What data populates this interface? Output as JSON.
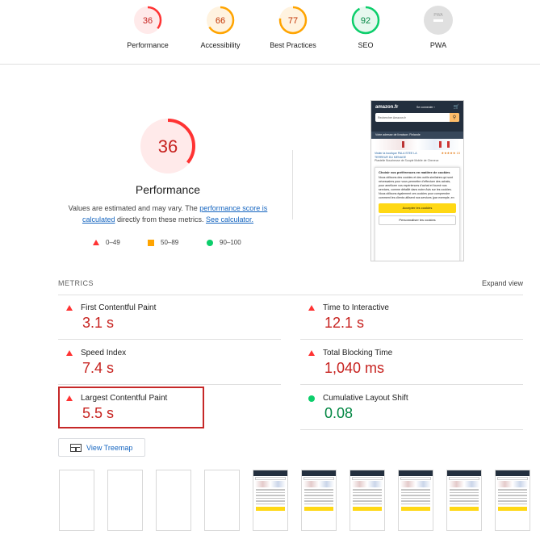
{
  "top_gauges": [
    {
      "score": "36",
      "label": "Performance",
      "value": 36,
      "rating": "fail"
    },
    {
      "score": "66",
      "label": "Accessibility",
      "value": 66,
      "rating": "average"
    },
    {
      "score": "77",
      "label": "Best Practices",
      "value": 77,
      "rating": "average"
    },
    {
      "score": "92",
      "label": "SEO",
      "value": 92,
      "rating": "pass"
    },
    {
      "score": "PWA",
      "label": "PWA",
      "value": null,
      "rating": "na"
    }
  ],
  "main": {
    "score": "36",
    "score_value": 36,
    "title": "Performance",
    "desc_pre": "Values are estimated and may vary. The ",
    "desc_link1": "performance score is calculated",
    "desc_mid": " directly from these metrics. ",
    "desc_link2": "See calculator."
  },
  "legend": {
    "fail": "0–49",
    "average": "50–89",
    "pass": "90–100"
  },
  "screenshot": {
    "logo": "amazon.fr",
    "account": "Se connecter ›",
    "cart_icon": "cart-icon",
    "search_placeholder": "Rechercher Amazon.fr",
    "address": "Votre adresse de livraison: Finlande",
    "product_title": "Visiter la boutique PALA STEE LA TERREUR DU MENAGE",
    "product_sub": "Plastelle Boucheuse de Souple Mobile de Cheveux",
    "rating_text": "★★★★★ 15",
    "cookie_title": "Choisir vos préférences en matière de cookies",
    "cookie_text": "Nous utilisons des cookies et des outils similaires qui sont nécessaires pour vous permettre d'effectuer des achats, pour améliorer vos expériences d'achat et fournir nos services, comme détaillé dans notre Avis sur les cookies. Nous utilisons également ces cookies pour comprendre comment les clients utilisent nos services (par exemple, en",
    "accept_label": "Accepter les cookies",
    "customize_label": "Personnaliser les cookies"
  },
  "metrics": {
    "title": "METRICS",
    "expand_label": "Expand view",
    "items": [
      {
        "label": "First Contentful Paint",
        "value": "3.1 s",
        "rating": "fail"
      },
      {
        "label": "Time to Interactive",
        "value": "12.1 s",
        "rating": "fail"
      },
      {
        "label": "Speed Index",
        "value": "7.4 s",
        "rating": "fail"
      },
      {
        "label": "Total Blocking Time",
        "value": "1,040 ms",
        "rating": "fail"
      },
      {
        "label": "Largest Contentful Paint",
        "value": "5.5 s",
        "rating": "fail"
      },
      {
        "label": "Cumulative Layout Shift",
        "value": "0.08",
        "rating": "pass"
      }
    ]
  },
  "treemap": {
    "label": "View Treemap",
    "icon": "treemap-icon"
  },
  "filmstrip": {
    "frames": [
      "blank",
      "blank",
      "blank",
      "blank",
      "page",
      "page",
      "page",
      "page",
      "page",
      "page"
    ]
  },
  "colors": {
    "fail": "#ff3333",
    "average": "#ffa400",
    "pass": "#0cce6b",
    "na": "#cccccc",
    "fail_text": "#c7221f",
    "pass_text": "#018642",
    "highlight": "#c62828"
  }
}
